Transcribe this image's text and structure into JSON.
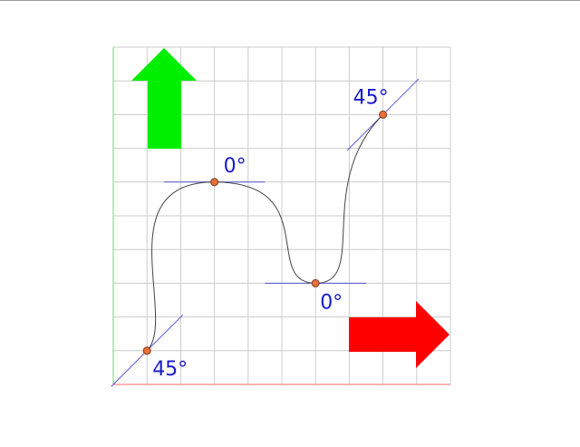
{
  "colors": {
    "background": "#ffffff",
    "grid": "#cccccc",
    "x_axis": "#ff6666",
    "y_axis": "#66dd66",
    "curve": "#444444",
    "tangent": "#3333cc",
    "point_fill": "#e8703a",
    "point_stroke": "#7a3a20",
    "label": "#1a1acc",
    "up_arrow": "#00ee00",
    "right_arrow": "#ff0000"
  },
  "grid": {
    "columns": 10,
    "rows": 10
  },
  "icons": {
    "up_arrow": "arrow-up-icon",
    "right_arrow": "arrow-right-icon"
  },
  "control_points": [
    {
      "x": 1,
      "y": 1,
      "angle_deg": 45,
      "label": "45°"
    },
    {
      "x": 3,
      "y": 6,
      "angle_deg": 0,
      "label": "0°"
    },
    {
      "x": 6,
      "y": 3,
      "angle_deg": 0,
      "label": "0°"
    },
    {
      "x": 8,
      "y": 8,
      "angle_deg": 45,
      "label": "45°"
    }
  ]
}
